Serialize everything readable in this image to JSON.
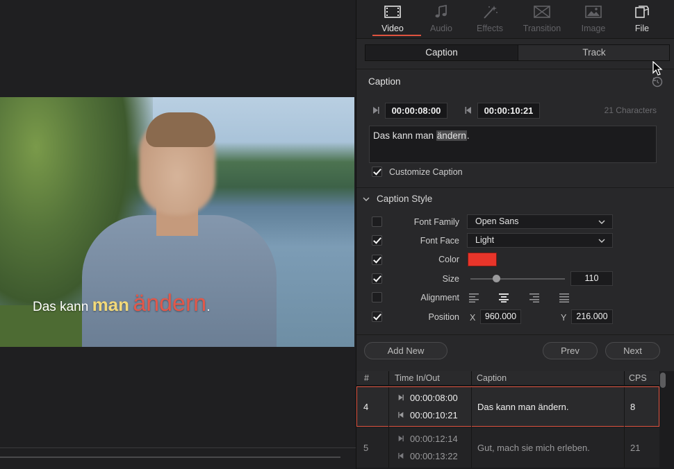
{
  "viewer": {
    "caption_words": [
      "Das kann",
      "man",
      "ändern",
      "."
    ]
  },
  "tabs": [
    {
      "label": "Video",
      "icon": "film-strip-icon"
    },
    {
      "label": "Audio",
      "icon": "music-note-icon"
    },
    {
      "label": "Effects",
      "icon": "magic-wand-icon"
    },
    {
      "label": "Transition",
      "icon": "transition-icon"
    },
    {
      "label": "Image",
      "icon": "image-icon"
    },
    {
      "label": "File",
      "icon": "file-icon"
    }
  ],
  "segmented": {
    "caption": "Caption",
    "track": "Track"
  },
  "caption_section": {
    "title": "Caption",
    "time_in": "00:00:08:00",
    "time_out": "00:00:10:21",
    "characters": "21 Characters",
    "text_before": "Das kann man ",
    "text_selected": "ändern",
    "text_after": ".",
    "customize_label": "Customize Caption"
  },
  "caption_style": {
    "title": "Caption Style",
    "font_family_label": "Font Family",
    "font_family_value": "Open Sans",
    "font_face_label": "Font Face",
    "font_face_value": "Light",
    "color_label": "Color",
    "color_value": "#e8352a",
    "size_label": "Size",
    "size_value": "110",
    "alignment_label": "Alignment",
    "position_label": "Position",
    "x_label": "X",
    "x_value": "960.000",
    "y_label": "Y",
    "y_value": "216.000"
  },
  "buttons": {
    "add_new": "Add New",
    "prev": "Prev",
    "next": "Next"
  },
  "table": {
    "headers": [
      "#",
      "Time In/Out",
      "Caption",
      "CPS"
    ],
    "rows": [
      {
        "num": "4",
        "in": "00:00:08:00",
        "out": "00:00:10:21",
        "caption": "Das kann man ändern.",
        "cps": "8"
      },
      {
        "num": "5",
        "in": "00:00:12:14",
        "out": "00:00:13:22",
        "caption": "Gut, mach sie mich erleben.",
        "cps": "21"
      }
    ]
  },
  "colors": {
    "accent": "#e0533f",
    "highlight_word": "#f2d97a",
    "changed_word": "#e2584a"
  }
}
